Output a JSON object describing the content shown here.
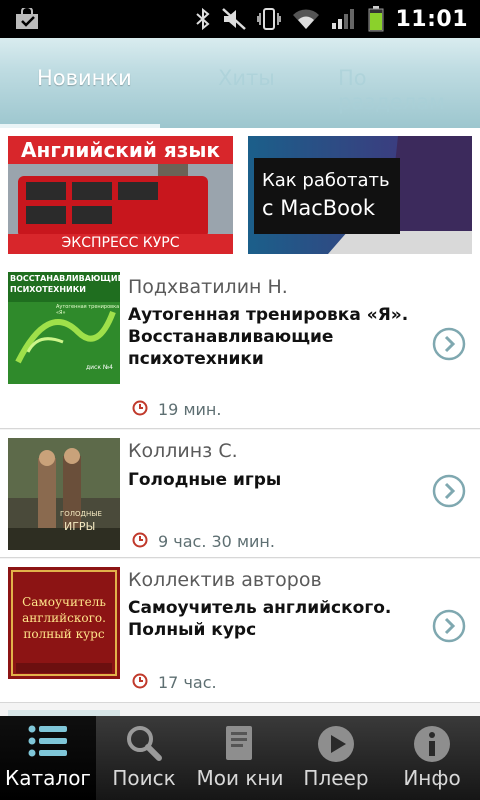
{
  "statusbar": {
    "time": "11:01"
  },
  "tabs": {
    "t1": "Новинки",
    "t2": "Хиты",
    "t3": "По разделам"
  },
  "banners": {
    "b1_title": "Английский язык",
    "b1_sub": "ЭКСПРЕСС КУРС",
    "b2_line1": "Как работать",
    "b2_line2": "с MacBook"
  },
  "books": [
    {
      "author": "Подхватилин Н.",
      "title": "Аутогенная тренировка «Я». Восстанавливающие психотехники",
      "duration": "19 мин.",
      "cover": {
        "line1": "ВОССТАНАВЛИВАЮЩИЕ",
        "line2": "ПСИХОТЕХНИКИ",
        "line3": "Аутогенная тренировка «Я»",
        "badge": "диск №4"
      }
    },
    {
      "author": "Коллинз С.",
      "title": "Голодные игры",
      "duration": "9 час. 30 мин.",
      "cover": {
        "line1": "ГОЛОДНЫЕ",
        "line2": "ИГРЫ"
      }
    },
    {
      "author": "Коллектив авторов",
      "title": "Самоучитель английского. Полный курс",
      "duration": "17 час.",
      "cover": {
        "line1": "Самоучитель",
        "line2": "английского.",
        "line3": "полный курс"
      }
    }
  ],
  "nav": {
    "catalog": "Каталог",
    "search": "Поиск",
    "mybooks": "Мои кни",
    "player": "Плеер",
    "info": "Инфо"
  },
  "colors": {
    "accent_tab": "#9cc6ce",
    "chevron": "#7fa8b0",
    "clock": "#c0392b"
  }
}
